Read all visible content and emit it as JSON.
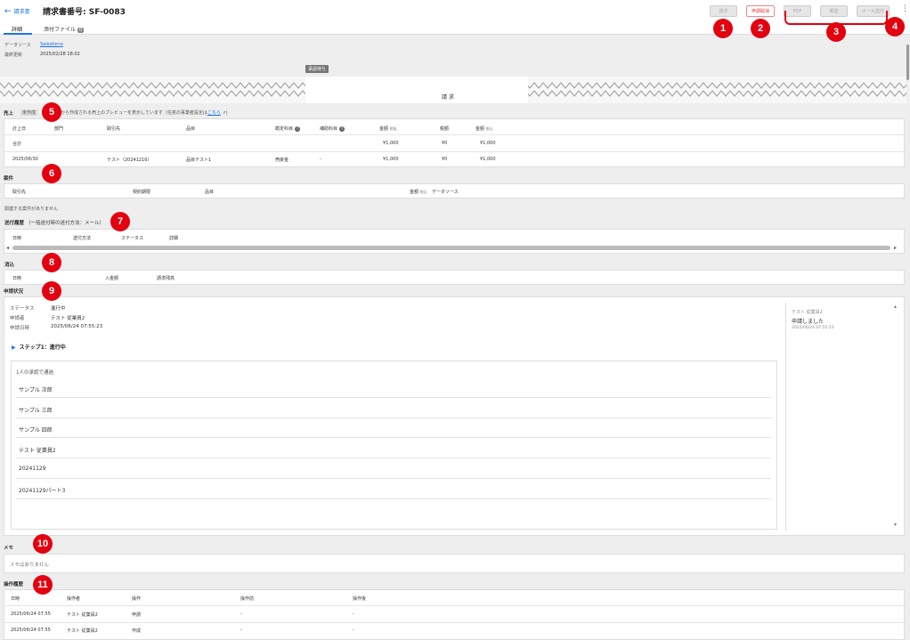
{
  "header": {
    "back_label": "請求書",
    "title": "請求書番号: SF-0083",
    "buttons": {
      "b1": "請求",
      "b2": "申請取消",
      "b3": "PDF",
      "b4": "郵送",
      "b5": "メール送付"
    }
  },
  "tabs": {
    "details": "詳細",
    "attachments": "添付ファイル",
    "attachments_count": "0"
  },
  "meta": {
    "source_label": "データソース",
    "source_value": "Salesforce",
    "updated_label": "最終更新",
    "updated_value": "2025/02/28 18:02"
  },
  "document": {
    "stamp": "承認待ち",
    "heading": "請 求"
  },
  "sales": {
    "label": "売上",
    "badge": "未作成",
    "note": "から作成される売上のプレビューを表示しています（任意の事業者設定は",
    "note_link": "こちら",
    "headers": [
      "計上日",
      "部門",
      "取引先",
      "品目",
      "勘定科目",
      "補助科目",
      "金額",
      "税抜",
      "税額",
      "金額",
      "税込"
    ],
    "total_label": "合計",
    "total_amount": "¥1,000",
    "total_tax": "¥0",
    "total_incl": "¥1,000",
    "row": {
      "date": "2025/06/30",
      "partner": "テスト（20241216）",
      "item": "品目テスト1",
      "account": "売掛金",
      "sub": "-",
      "amount": "¥1,000",
      "tax": "¥0",
      "incl": "¥1,000"
    }
  },
  "deals": {
    "label": "案件",
    "headers": [
      "取引先",
      "契約期限",
      "品目",
      "金額",
      "税込",
      "データソース"
    ],
    "empty": "関連する案件がありません"
  },
  "delivery": {
    "label": "送付履歴",
    "sub": "（一括送付時の送付方法：メール）",
    "headers": [
      "日時",
      "送付方法",
      "ステータス",
      "詳細"
    ]
  },
  "payments": {
    "label": "消込",
    "headers": [
      "日時",
      "入金額",
      "請求残高"
    ]
  },
  "application": {
    "label": "申請状況",
    "status_label": "ステータス",
    "status_value": "進行中",
    "applicant_label": "申請者",
    "applicant_value": "テスト 従業員2",
    "date_label": "申請日時",
    "date_value": "2025/06/24 07:55:23",
    "step": "ステップ1：進行中",
    "approver_rule": "1人の承認で通過",
    "approvers": [
      "サンプル 次郎",
      "サンプル 三郎",
      "サンプル 四郎",
      "テスト 従業員2",
      "20241129",
      "20241129パート3"
    ],
    "comment_name": "テスト 従業員2",
    "comment_text": "申請しました",
    "comment_date": "2025/06/24 07:55:23"
  },
  "memo": {
    "label": "メモ",
    "empty": "メモはありません"
  },
  "history": {
    "label": "操作履歴",
    "headers": [
      "日時",
      "操作者",
      "操作",
      "操作前",
      "操作後"
    ],
    "rows": [
      {
        "date": "2025/06/24 07:55",
        "user": "テスト 従業員2",
        "op": "申請",
        "before": "-",
        "after": "-"
      },
      {
        "date": "2025/06/24 07:55",
        "user": "テスト 従業員2",
        "op": "作成",
        "before": "-",
        "after": "-"
      }
    ]
  },
  "callouts": [
    "1",
    "2",
    "3",
    "4",
    "5",
    "6",
    "7",
    "8",
    "9",
    "10",
    "11"
  ],
  "colors": {
    "callout": "#e3000f",
    "link": "#1a73e8",
    "cancel_text": "#dd3333"
  }
}
